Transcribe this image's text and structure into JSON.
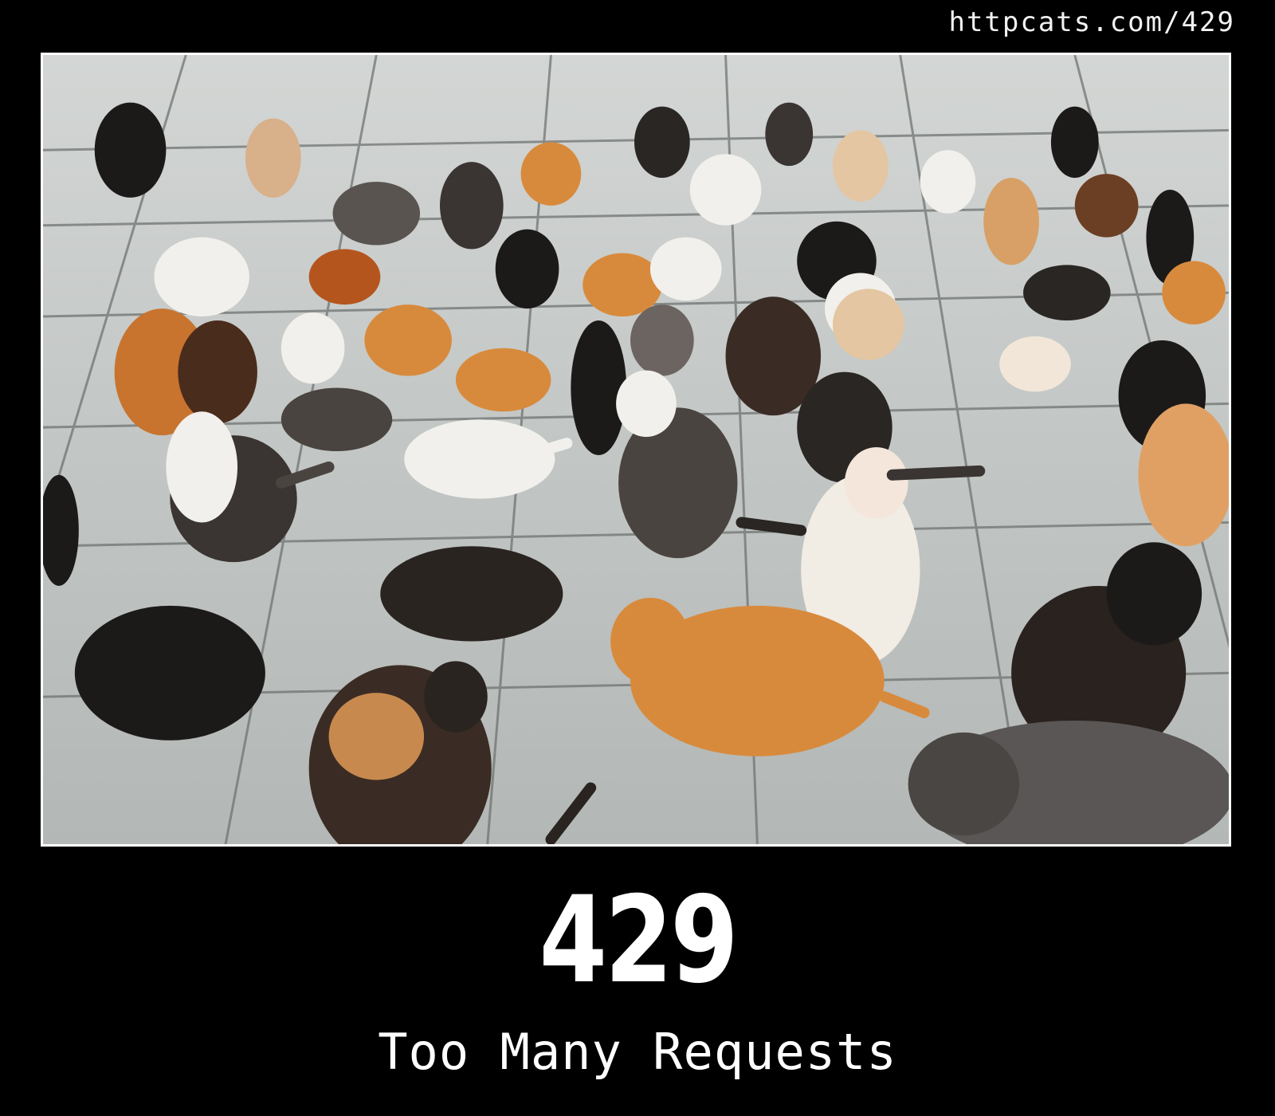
{
  "header": {
    "url": "httpcats.com/429"
  },
  "photo": {
    "subject": "many-cats-on-tiled-courtyard",
    "colors": {
      "tile": "#c4c7c5",
      "grout": "#6f7472",
      "orange": "#d88a3c",
      "white": "#f1f0ec",
      "black": "#1c1a19",
      "tabby": "#5a5450",
      "calico": "#7a4a2c"
    }
  },
  "status": {
    "code": "429",
    "message": "Too Many Requests"
  }
}
